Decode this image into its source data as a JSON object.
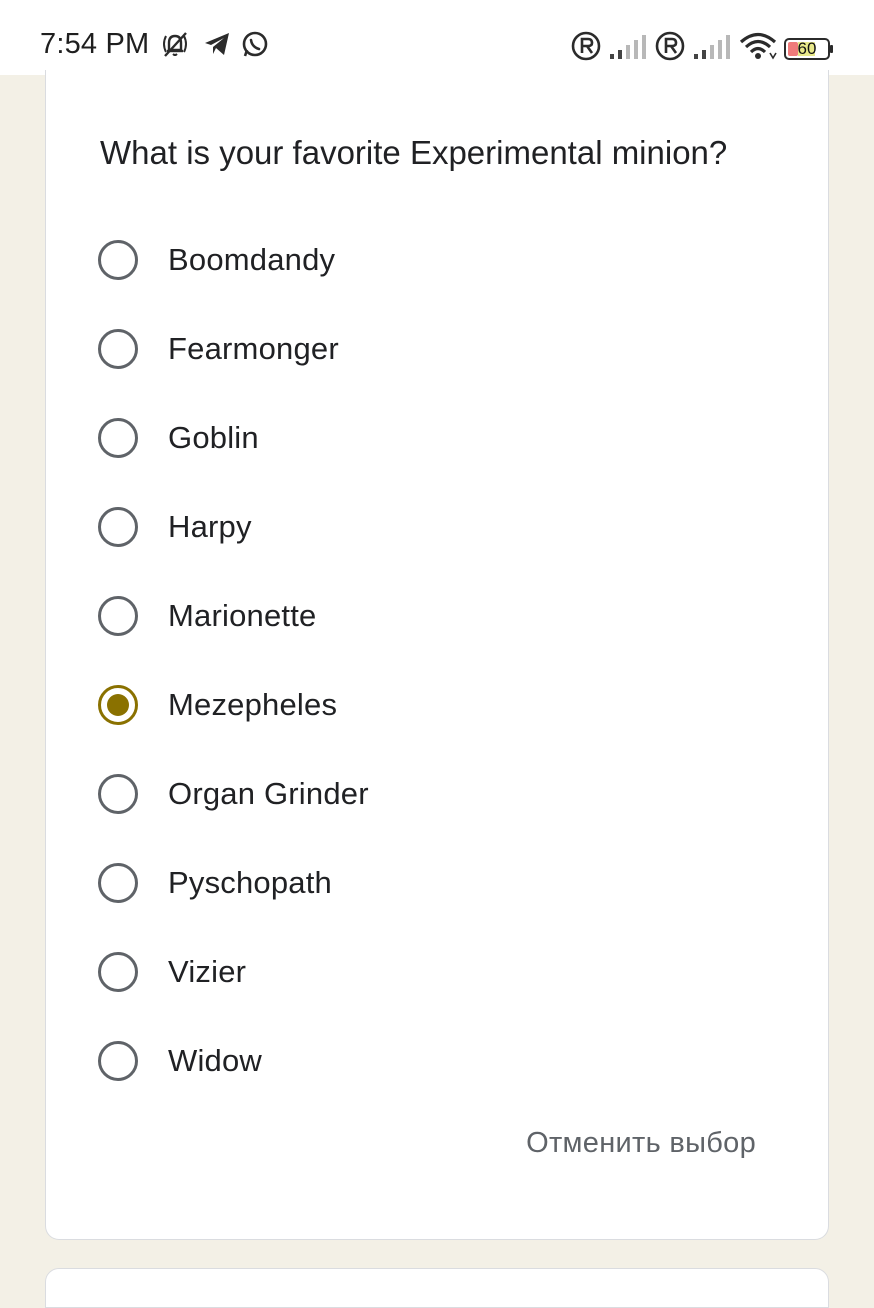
{
  "status_bar": {
    "time": "7:54 PM",
    "battery_level": "60",
    "icons": [
      "muted-bell-icon",
      "telegram-icon",
      "whatsapp-icon",
      "roaming-icon",
      "signal-icon",
      "roaming-icon",
      "signal-icon",
      "wifi-icon",
      "battery-icon"
    ]
  },
  "question": {
    "title": "What is your favorite Experimental minion?",
    "options": [
      {
        "label": "Boomdandy",
        "selected": false
      },
      {
        "label": "Fearmonger",
        "selected": false
      },
      {
        "label": "Goblin",
        "selected": false
      },
      {
        "label": "Harpy",
        "selected": false
      },
      {
        "label": "Marionette",
        "selected": false
      },
      {
        "label": "Mezepheles",
        "selected": true
      },
      {
        "label": "Organ Grinder",
        "selected": false
      },
      {
        "label": "Pyschopath",
        "selected": false
      },
      {
        "label": "Vizier",
        "selected": false
      },
      {
        "label": "Widow",
        "selected": false
      }
    ],
    "clear_label": "Отменить выбор"
  },
  "colors": {
    "accent": "#8a7100",
    "page_background": "#f3f0e6",
    "radio_border": "#5f6368"
  }
}
